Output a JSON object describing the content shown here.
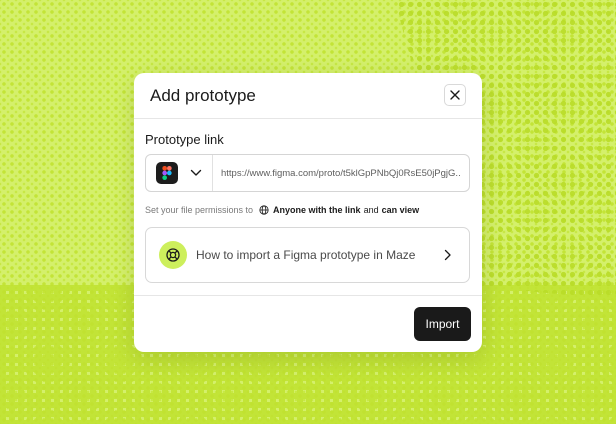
{
  "modal": {
    "title": "Add prototype",
    "close_icon": "close-icon",
    "field_label": "Prototype link",
    "tool_icon": "figma-logo-icon",
    "url_value": "https://www.figma.com/proto/t5klGpPNbQj0RsE50jPgjG...",
    "permissions": {
      "prefix": "Set your file permissions to",
      "icon": "globe-icon",
      "strong1": "Anyone with the link",
      "and": "and",
      "strong2": "can view"
    },
    "help": {
      "icon": "lifebuoy-icon",
      "text": "How to import a Figma prototype in Maze"
    },
    "import_label": "Import"
  },
  "colors": {
    "background": "#d4f06b",
    "accent": "#cdef5c",
    "button": "#1a1a1a"
  }
}
